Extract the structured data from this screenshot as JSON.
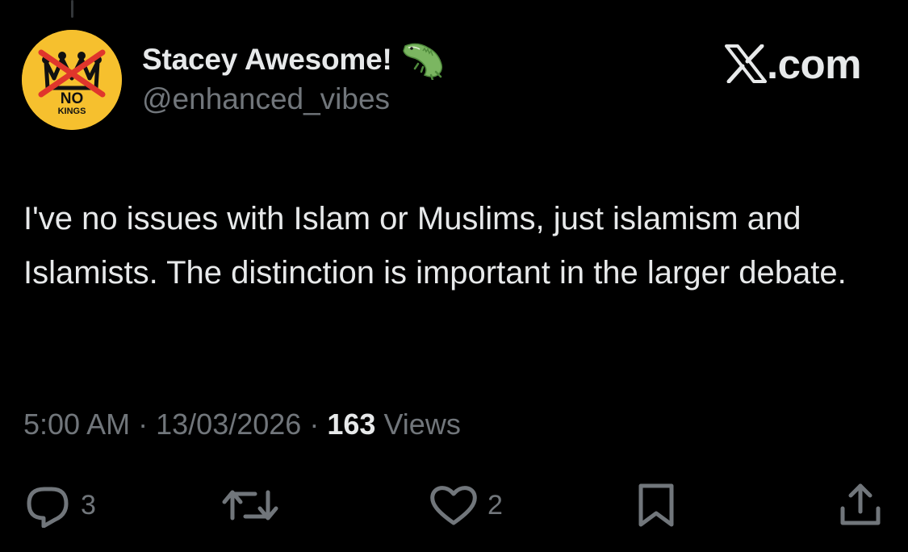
{
  "author": {
    "display_name": "Stacey Awesome!",
    "handle": "@enhanced_vibes",
    "display_name_emoji": "crocodile-emoji",
    "avatar": {
      "text_top": "NO",
      "text_bottom": "KINGS",
      "background_color": "#f6c02e",
      "strike_color": "#e0362c"
    }
  },
  "brand": {
    "icon": "x-logo-icon",
    "domain": ".com"
  },
  "tweet": {
    "text": "I've no issues with Islam or Muslims, just islamism and Islamists. The distinction is important in the larger debate.",
    "time": "5:00 AM",
    "separator": "·",
    "date": "13/03/2026",
    "views_count": "163",
    "views_label": "Views"
  },
  "actions": {
    "reply_count": "3",
    "like_count": "2"
  },
  "colors": {
    "background": "#000000",
    "primary_text": "#e7e9ea",
    "secondary_text": "#71767b"
  }
}
